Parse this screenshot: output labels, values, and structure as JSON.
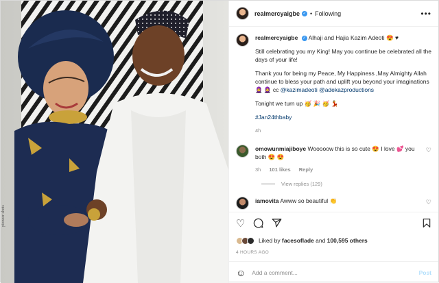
{
  "post": {
    "photo_watermark": "pioneer shots",
    "header": {
      "username": "realmercyaigbe",
      "verified_icon": "verified-badge-icon",
      "separator": "•",
      "follow_label": "Following",
      "more_icon": "more-options-icon"
    },
    "caption": {
      "username": "realmercyaigbe",
      "title": "Alhaji and Hajia Kazim Adeoti 😍 ♥",
      "para1": "Still celebrating you my King! May you continue be celebrated all the days of your life!",
      "para2_text": "Thank you for being my Peace, My Happiness ,May Almighty Allah continue to bless your path and uplift you beyond your imaginations 🧕 🧕 cc ",
      "mention1": "@kazimadeoti",
      "mention2": "@adekazproductions",
      "para3": "Tonight we turn up 🥳 🎉 🥳 💃",
      "hashtag": "#Jan24thbaby",
      "age": "4h"
    },
    "comments": [
      {
        "username": "omowunmiajiboye",
        "text": "Wooooow this is so cute 😍 I love 💕 you both 😍 😍",
        "age": "3h",
        "likes": "101 likes",
        "reply": "Reply",
        "view_replies": "View replies (129)"
      },
      {
        "username": "iamovita",
        "text": "Awww so beautiful 👏"
      }
    ],
    "actions": {
      "like_icon": "heart-icon",
      "comment_icon": "comment-icon",
      "share_icon": "share-icon",
      "save_icon": "bookmark-icon"
    },
    "likes": {
      "prefix": "Liked by",
      "user": "facesoflade",
      "and": "and",
      "others": "100,595 others"
    },
    "timestamp": "4 HOURS AGO",
    "add_comment": {
      "placeholder": "Add a comment...",
      "post_label": "Post"
    }
  }
}
